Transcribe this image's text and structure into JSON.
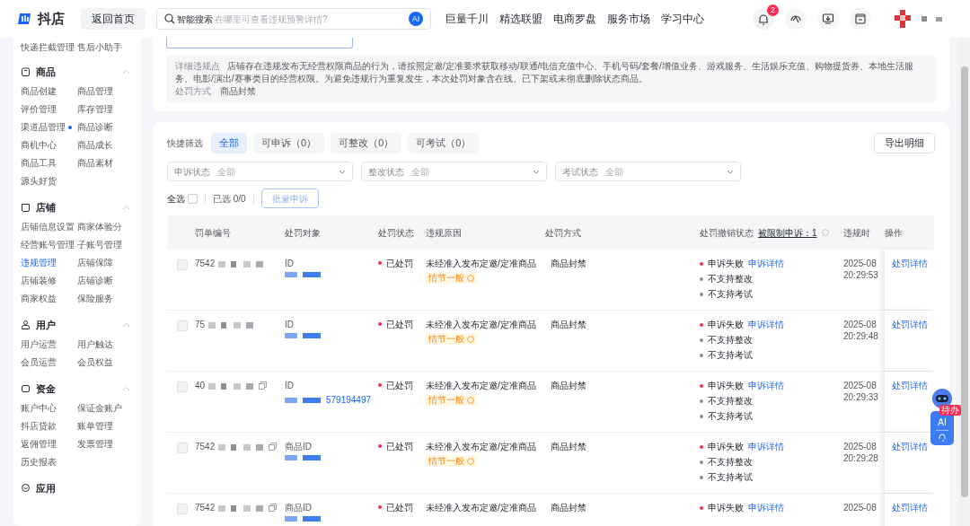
{
  "topbar": {
    "logo_text": "抖店",
    "home_button": "返回首页",
    "search": {
      "label": "智能搜索",
      "placeholder": "在哪里可查看违规预警详情?",
      "ai_badge": "AI"
    },
    "nav": [
      "巨量千川",
      "精选联盟",
      "电商罗盘",
      "服务市场",
      "学习中心"
    ],
    "notification_count": "2"
  },
  "sidebar": {
    "top_items": [
      {
        "label": "快递拦截管理",
        "selected": false,
        "dot": false
      },
      {
        "label": "售后小助手",
        "selected": false,
        "dot": false
      }
    ],
    "sections": [
      {
        "title": "商品",
        "expanded": true,
        "items": [
          {
            "label": "商品创建",
            "selected": false,
            "dot": false
          },
          {
            "label": "商品管理",
            "selected": false,
            "dot": false
          },
          {
            "label": "评价管理",
            "selected": false,
            "dot": false
          },
          {
            "label": "库存管理",
            "selected": false,
            "dot": false
          },
          {
            "label": "渠道品管理",
            "selected": false,
            "dot": true
          },
          {
            "label": "商品诊断",
            "selected": false,
            "dot": false
          },
          {
            "label": "商机中心",
            "selected": false,
            "dot": false
          },
          {
            "label": "商品成长",
            "selected": false,
            "dot": false
          },
          {
            "label": "商品工具",
            "selected": false,
            "dot": false
          },
          {
            "label": "商品素材",
            "selected": false,
            "dot": false
          },
          {
            "label": "源头好货",
            "selected": false,
            "dot": false
          }
        ]
      },
      {
        "title": "店铺",
        "expanded": true,
        "items": [
          {
            "label": "店铺信息设置",
            "selected": false,
            "dot": false
          },
          {
            "label": "商家体验分",
            "selected": false,
            "dot": false
          },
          {
            "label": "经营账号管理",
            "selected": false,
            "dot": false
          },
          {
            "label": "子账号管理",
            "selected": false,
            "dot": false
          },
          {
            "label": "违规管理",
            "selected": true,
            "dot": false
          },
          {
            "label": "店铺保障",
            "selected": false,
            "dot": false
          },
          {
            "label": "店铺装修",
            "selected": false,
            "dot": false
          },
          {
            "label": "店铺诊断",
            "selected": false,
            "dot": false
          },
          {
            "label": "商家权益",
            "selected": false,
            "dot": false
          },
          {
            "label": "保险服务",
            "selected": false,
            "dot": false
          }
        ]
      },
      {
        "title": "用户",
        "expanded": true,
        "items": [
          {
            "label": "用户运营",
            "selected": false,
            "dot": false
          },
          {
            "label": "用户触达",
            "selected": false,
            "dot": false
          },
          {
            "label": "会员运营",
            "selected": false,
            "dot": false
          },
          {
            "label": "会员权益",
            "selected": false,
            "dot": false
          }
        ]
      },
      {
        "title": "资金",
        "expanded": true,
        "items": [
          {
            "label": "账户中心",
            "selected": false,
            "dot": false
          },
          {
            "label": "保证金账户",
            "selected": false,
            "dot": false
          },
          {
            "label": "抖店贷款",
            "selected": false,
            "dot": false
          },
          {
            "label": "账单管理",
            "selected": false,
            "dot": false
          },
          {
            "label": "返佣管理",
            "selected": false,
            "dot": false
          },
          {
            "label": "发票管理",
            "selected": false,
            "dot": false
          },
          {
            "label": "历史报表",
            "selected": false,
            "dot": false
          }
        ]
      },
      {
        "title": "应用",
        "expanded": false
      }
    ]
  },
  "detail": {
    "rule_label": "详细违规点",
    "rule_text": "店铺存在违规发布无经营权限商品的行为，请按照定邀/定准要求获取移动/联通/电信充值中心、手机号码/套餐/增值业务、游戏服务、生活娱乐充值、购物提货券、本地生活服务、电影/演出/赛事类目的经营权限。为避免违规行为重复发生，本次处罚对象含在线、已下架或未彻底删除状态商品。",
    "method_label": "处罚方式",
    "method_value": "商品封禁"
  },
  "quick_filter": {
    "label": "快捷筛选",
    "chips": [
      {
        "label": "全部",
        "selected": true
      },
      {
        "label": "可申诉（0）",
        "selected": false
      },
      {
        "label": "可整改（0）",
        "selected": false
      },
      {
        "label": "可考试（0）",
        "selected": false
      }
    ],
    "export_button": "导出明细"
  },
  "selects": [
    {
      "label": "申诉状态",
      "value": "全部"
    },
    {
      "label": "整改状态",
      "value": "全部"
    },
    {
      "label": "考试状态",
      "value": "全部"
    }
  ],
  "bulk": {
    "select_all": "全选",
    "select_all_checked": false,
    "selected_count": "已选 0/0",
    "bulk_button": "批量申诉"
  },
  "table": {
    "columns": [
      "罚单编号",
      "处罚对象",
      "处罚状态",
      "违规原因",
      "处罚方式",
      "处罚撤销状态",
      "违规时",
      "操作"
    ],
    "restricted_link": "被限制申诉：1",
    "rows": [
      {
        "order_no": "7542",
        "copy": false,
        "object_label": "ID",
        "status": "已处罚",
        "reason": "未经准入发布定邀/定准商品",
        "tag": "情节一般",
        "method": "商品封禁",
        "appeal": "申诉失败",
        "appeal_link": "申诉详情",
        "sub_states": [
          "不支持整改",
          "不支持考试"
        ],
        "date": "2025-08",
        "time": "20:29:53",
        "action": "处罚详情",
        "checked": false
      },
      {
        "order_no": "75",
        "copy": false,
        "object_label": "ID",
        "status": "已处罚",
        "reason": "未经准入发布定邀/定准商品",
        "tag": "情节一般",
        "method": "商品封禁",
        "appeal": "申诉失败",
        "appeal_link": "申诉详情",
        "sub_states": [
          "不支持整改",
          "不支持考试"
        ],
        "date": "2025-08",
        "time": "20:29:48",
        "action": "处罚详情",
        "checked": false
      },
      {
        "order_no": "40",
        "copy": true,
        "object_label": "ID",
        "object_id": "579194497",
        "status": "已处罚",
        "reason": "未经准入发布定邀/定准商品",
        "tag": "情节一般",
        "method": "商品封禁",
        "appeal": "申诉失败",
        "appeal_link": "申诉详情",
        "sub_states": [
          "不支持整改",
          "不支持考试"
        ],
        "date": "2025-08",
        "time": "20:29:33",
        "action": "处罚详情",
        "checked": false
      },
      {
        "order_no": "7542",
        "copy": true,
        "object_label": "商品ID",
        "status": "已处罚",
        "reason": "未经准入发布定邀/定准商品",
        "tag": "情节一般",
        "method": "商品封禁",
        "appeal": "申诉失败",
        "appeal_link": "申诉详情",
        "sub_states": [
          "不支持整改",
          "不支持考试"
        ],
        "date": "2025-08",
        "time": "20:29:28",
        "action": "处罚详情",
        "checked": false
      },
      {
        "order_no": "7542",
        "copy": true,
        "object_label": "商品ID",
        "status": "已处罚",
        "reason": "未经准入发布定邀/定准商品",
        "method": "商品封禁",
        "appeal": "申诉失败",
        "appeal_link": "申诉详情",
        "sub_states": [],
        "date": "2025-08",
        "action": "处罚详情",
        "checked": false
      }
    ]
  },
  "assistant": {
    "badge": "待办",
    "ai_label": "AI"
  }
}
